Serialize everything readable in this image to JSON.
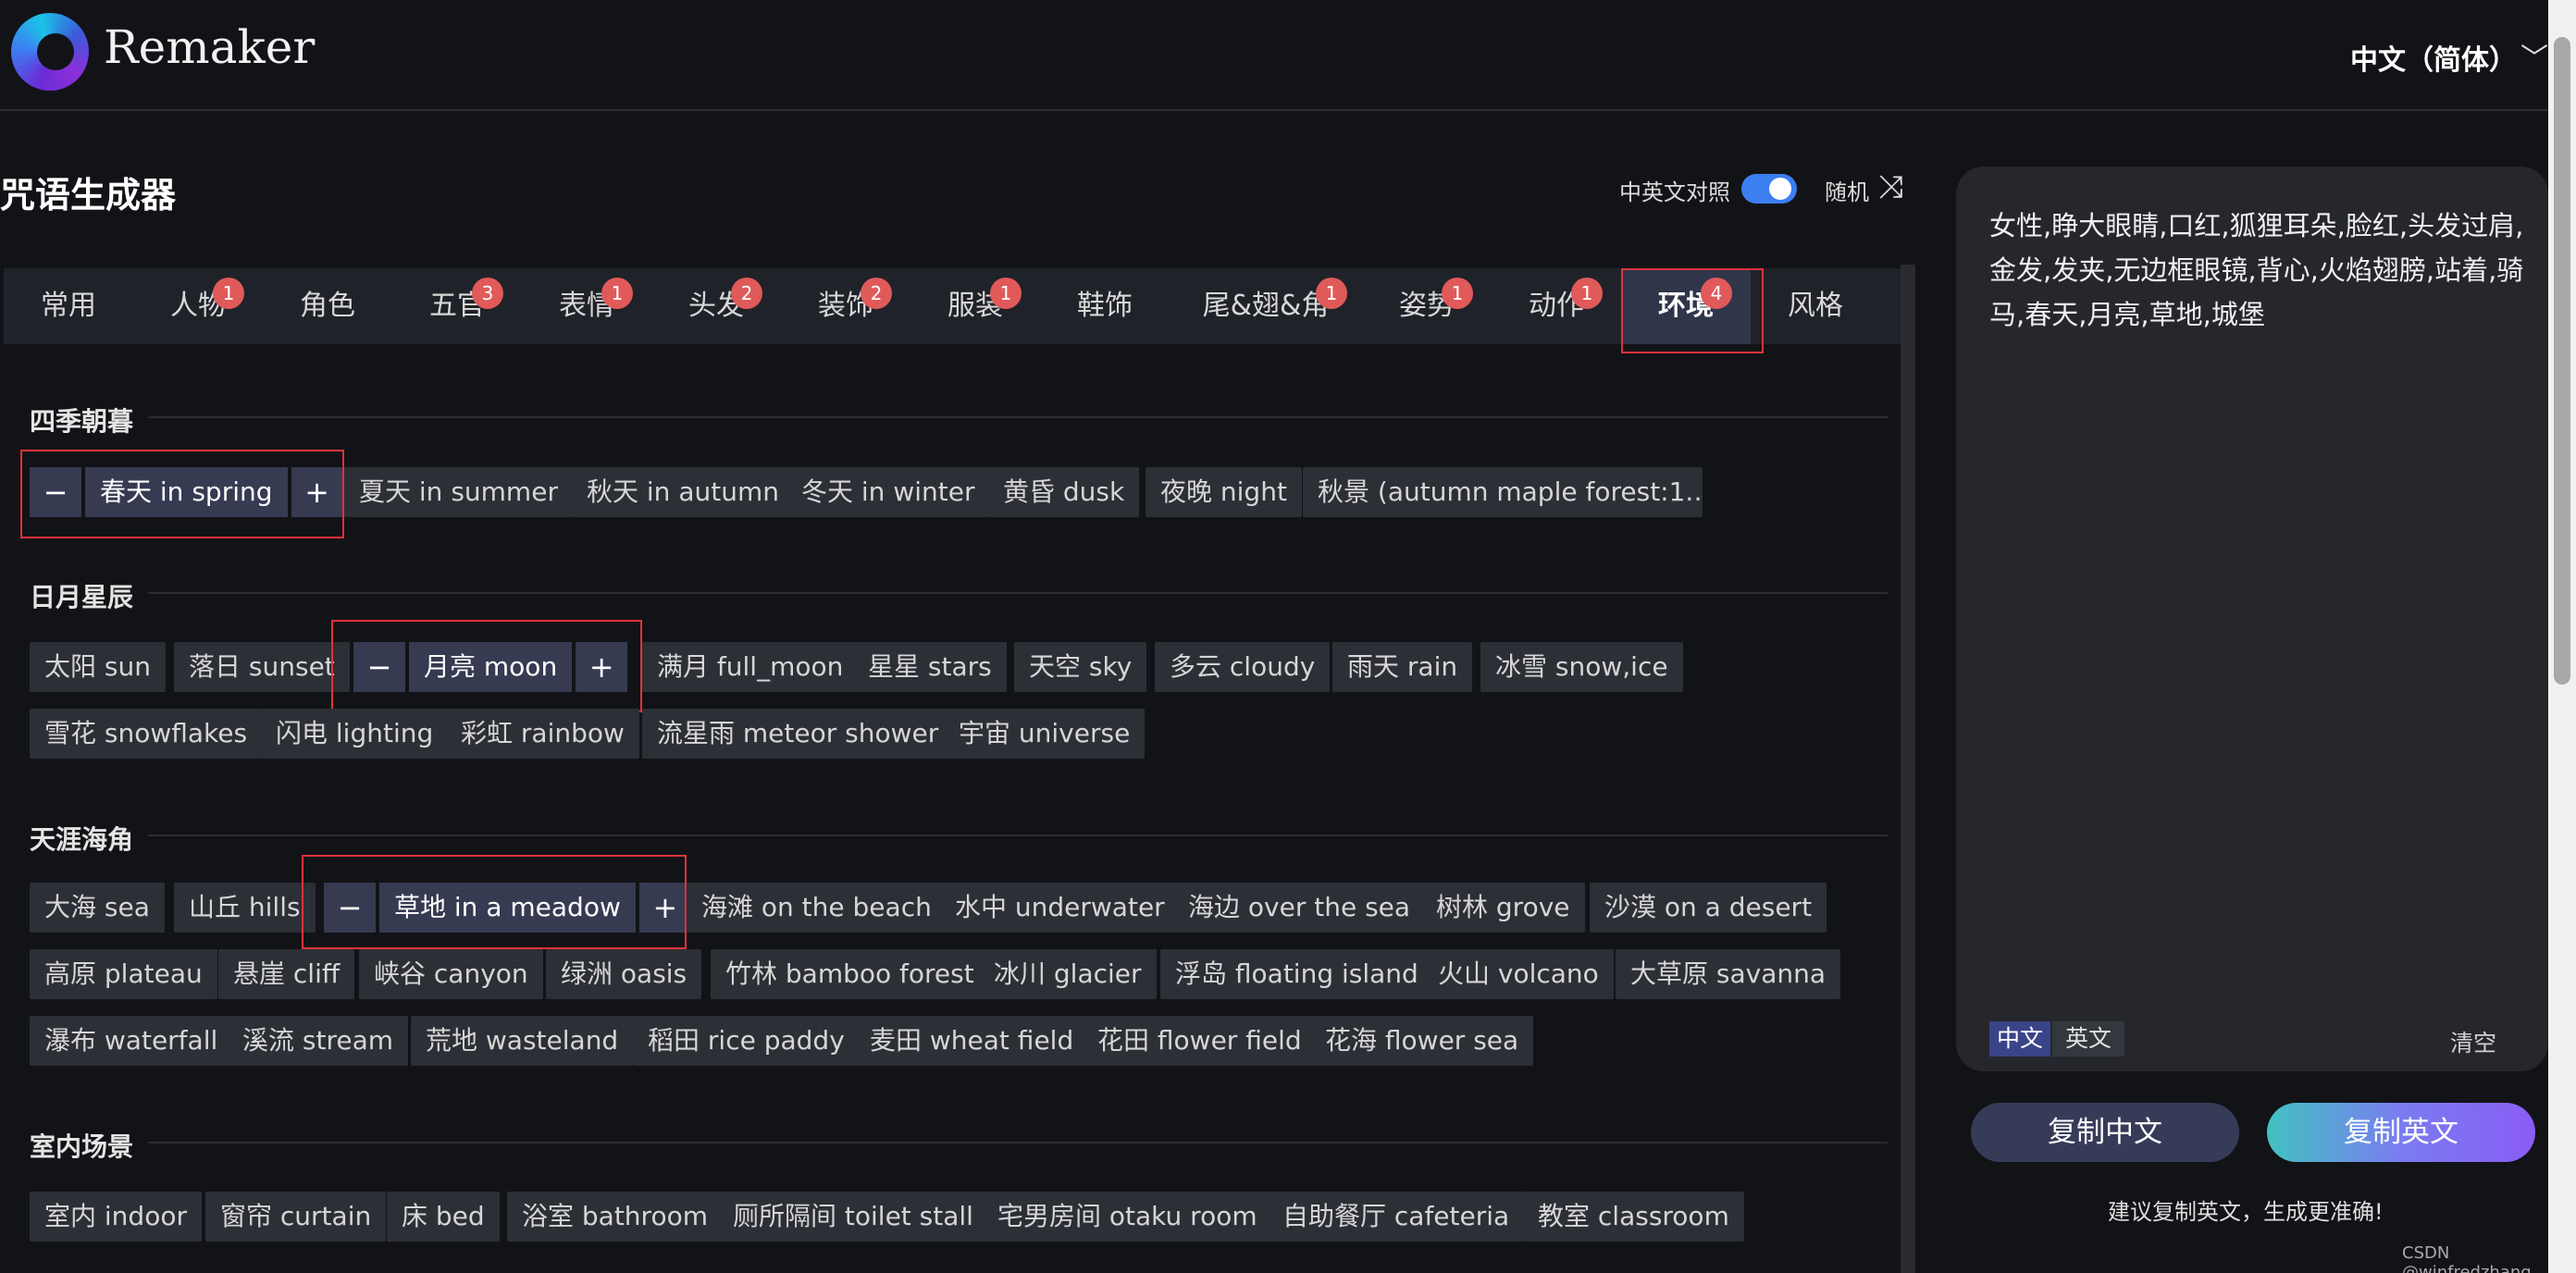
{
  "header": {
    "brand": "Remaker",
    "language": "中文（简体）"
  },
  "page": {
    "title": "咒语生成器",
    "toggle_label": "中英文对照",
    "random_label": "随机"
  },
  "tabs": [
    {
      "label": "常用",
      "badge": ""
    },
    {
      "label": "人物",
      "badge": "1"
    },
    {
      "label": "角色",
      "badge": ""
    },
    {
      "label": "五官",
      "badge": "3"
    },
    {
      "label": "表情",
      "badge": "1"
    },
    {
      "label": "头发",
      "badge": "2"
    },
    {
      "label": "装饰",
      "badge": "2"
    },
    {
      "label": "服装",
      "badge": "1"
    },
    {
      "label": "鞋饰",
      "badge": ""
    },
    {
      "label": "尾&翅&角",
      "badge": "1"
    },
    {
      "label": "姿势",
      "badge": "1"
    },
    {
      "label": "动作",
      "badge": "1"
    },
    {
      "label": "环境",
      "badge": "4"
    },
    {
      "label": "风格",
      "badge": ""
    }
  ],
  "sections": [
    {
      "title": "四季朝暮",
      "tags": [
        "春天 in spring",
        "夏天 in summer",
        "秋天 in autumn",
        "冬天 in winter",
        "黄昏 dusk",
        "夜晚 night",
        "秋景 (autumn maple forest:1.…"
      ]
    },
    {
      "title": "日月星辰",
      "tags": [
        "太阳 sun",
        "落日 sunset",
        "月亮 moon",
        "满月 full_moon",
        "星星 stars",
        "天空 sky",
        "多云 cloudy",
        "雨天 rain",
        "冰雪 snow,ice",
        "雪花 snowflakes",
        "闪电 lighting",
        "彩虹 rainbow",
        "流星雨 meteor shower",
        "宇宙 universe"
      ]
    },
    {
      "title": "天涯海角",
      "tags": [
        "大海 sea",
        "山丘 hills",
        "草地 in a meadow",
        "海滩 on the beach",
        "水中 underwater",
        "海边 over the sea",
        "树林 grove",
        "沙漠 on a desert",
        "高原 plateau",
        "悬崖 cliff",
        "峡谷 canyon",
        "绿洲 oasis",
        "竹林 bamboo forest",
        "冰川 glacier",
        "浮岛 floating island",
        "火山 volcano",
        "大草原 savanna",
        "瀑布 waterfall",
        "溪流 stream",
        "荒地 wasteland",
        "稻田 rice paddy",
        "麦田 wheat field",
        "花田 flower field",
        "花海 flower sea"
      ]
    },
    {
      "title": "室内场景",
      "tags": [
        "室内 indoor",
        "窗帘 curtain",
        "床 bed",
        "浴室 bathroom",
        "厕所隔间 toilet stall",
        "宅男房间 otaku room",
        "自助餐厅 cafeteria",
        "教室 classroom"
      ]
    }
  ],
  "controls": {
    "minus": "−",
    "plus": "+"
  },
  "panel": {
    "prompt": "女性,睁大眼睛,口红,狐狸耳朵,脸红,头发过肩,金发,发夹,无边框眼镜,背心,火焰翅膀,站着,骑马,春天,月亮,草地,城堡",
    "seg_cn": "中文",
    "seg_en": "英文",
    "clear": "清空",
    "copy_cn": "复制中文",
    "copy_en": "复制英文",
    "hint": "建议复制英文，生成更准确!"
  },
  "icons": {
    "shuffle": "⤨",
    "chevron": "﹀"
  },
  "colors": {
    "accent": "#3b7ff0",
    "badge": "#e05a5a",
    "highlight": "#e0323c",
    "selected_chip": "#363b52"
  },
  "watermark": "CSDN @winfredzhang"
}
